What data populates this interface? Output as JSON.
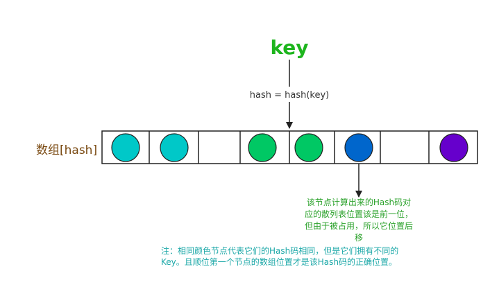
{
  "key_text": "key",
  "hash_formula": "hash = hash(key)",
  "array_label": "数组[hash]",
  "node_note_lines": [
    "该节点计算出来的Hash码对",
    "应的散列表位置该是前一位，",
    "但由于被占用，所以它位置后",
    "移"
  ],
  "footer_lines": [
    "注：相同颜色节点代表它们的Hash码相同，但是它们拥有不同的",
    "Key。且顺位第一个节点的数组位置才是该Hash码的正确位置。"
  ],
  "slots": [
    {
      "node": true,
      "color": "#00c8c8"
    },
    {
      "node": true,
      "color": "#00c8c8"
    },
    {
      "node": false
    },
    {
      "node": true,
      "color": "#00c864"
    },
    {
      "node": true,
      "color": "#00c864"
    },
    {
      "node": true,
      "color": "#0066cc"
    },
    {
      "node": false
    },
    {
      "node": true,
      "color": "#6600cc"
    }
  ],
  "colors": {
    "key": "#1db51d",
    "array_label": "#7a4a12",
    "note": "#2aa12a",
    "footer": "#1ca8a8",
    "lines": "#222222"
  }
}
